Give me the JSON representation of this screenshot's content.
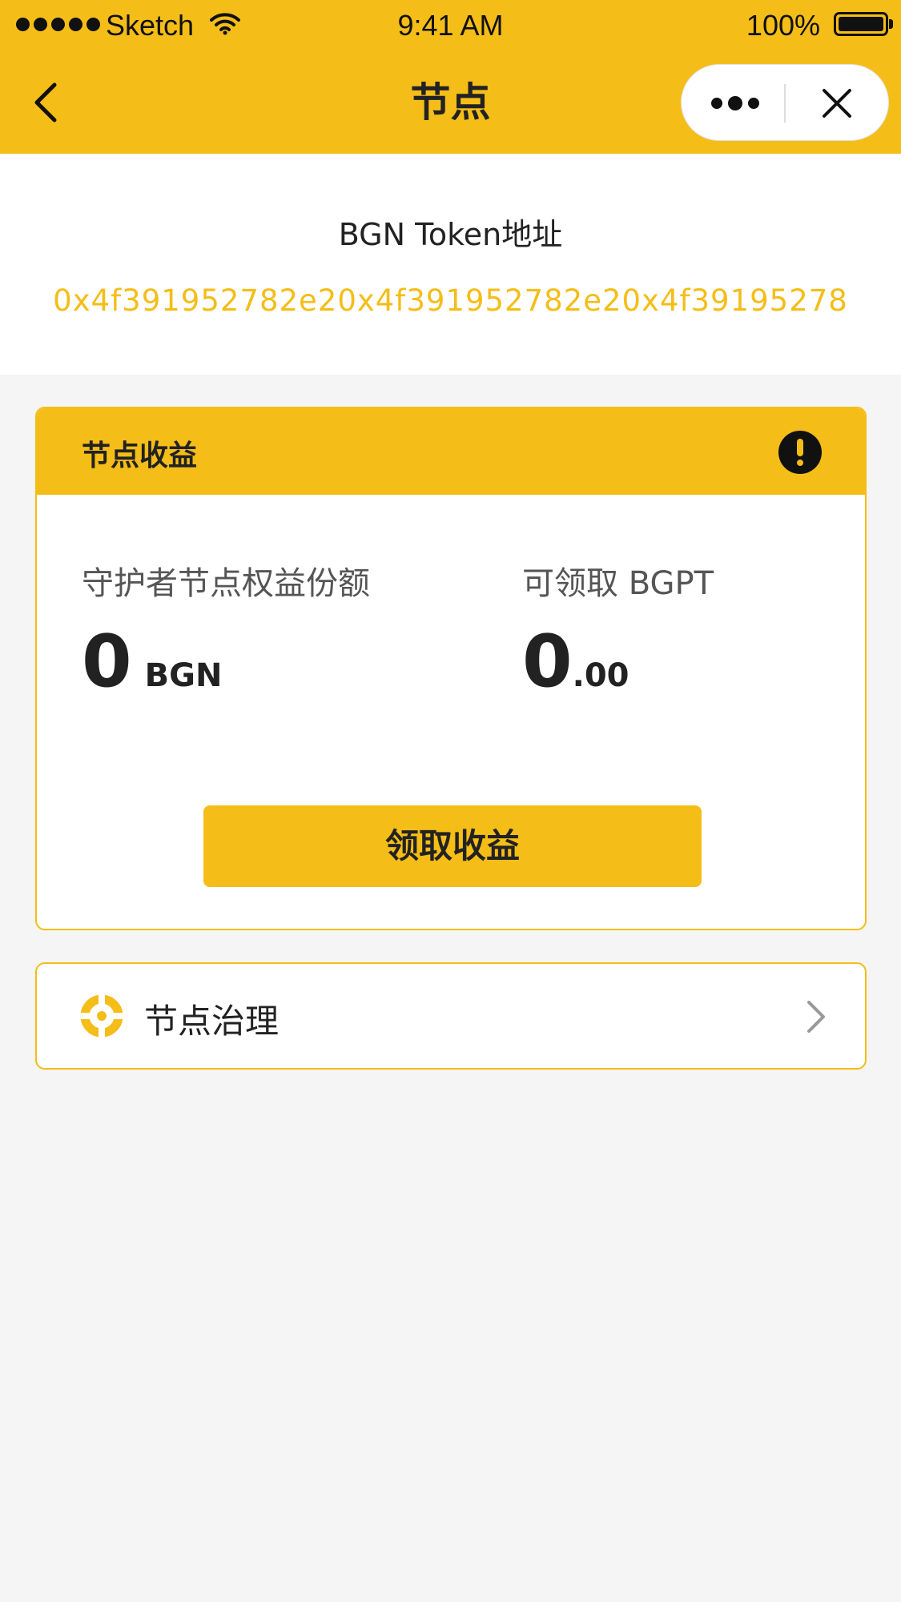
{
  "status_bar": {
    "carrier": "Sketch",
    "time": "9:41 AM",
    "battery": "100%"
  },
  "nav": {
    "title": "节点"
  },
  "address": {
    "label": "BGN Token地址",
    "value": "0x4f391952782e20x4f391952782e20x4f39195278"
  },
  "earnings": {
    "title": "节点收益",
    "share_label": "守护者节点权益份额",
    "share_value": "0",
    "share_unit": "BGN",
    "claimable_label": "可领取 BGPT",
    "claimable_int": "0",
    "claimable_dec": ".00",
    "claim_button": "领取收益"
  },
  "governance": {
    "label": "节点治理"
  },
  "colors": {
    "accent": "#f5bd18",
    "background": "#f5f5f5",
    "text": "#222222"
  },
  "icons": [
    "chevron-left-icon",
    "more-icon",
    "close-icon",
    "alert-icon",
    "target-icon",
    "chevron-right-icon",
    "wifi-icon",
    "battery-icon",
    "signal-icon"
  ]
}
